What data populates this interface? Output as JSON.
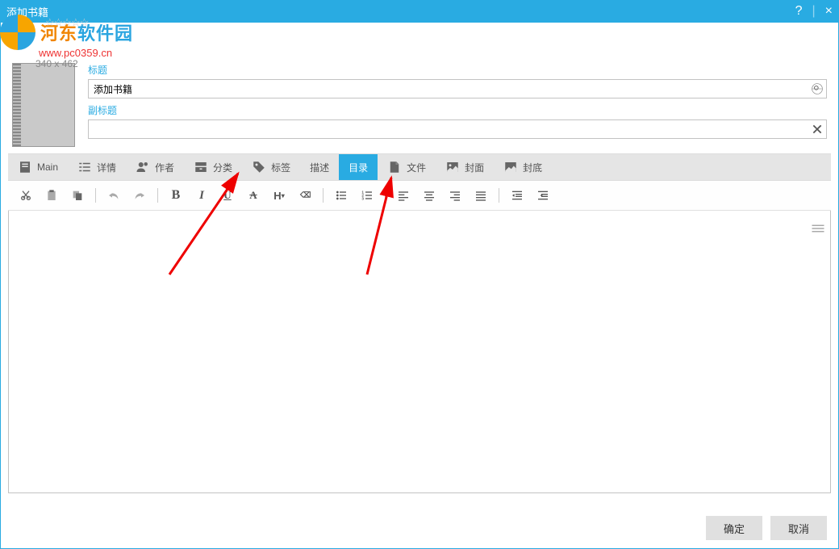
{
  "window": {
    "title": "添加书籍",
    "help": "?",
    "close": "×"
  },
  "watermark": {
    "brand_colored": "河东",
    "brand_rest": "软件园",
    "url": "www.pc0359.cn",
    "dimensions": "340 x  462",
    "stars": "☆☆☆☆☆"
  },
  "fields": {
    "title_label": "标题",
    "title_value": "添加书籍",
    "subtitle_label": "副标题",
    "subtitle_value": ""
  },
  "tabs": [
    {
      "id": "main",
      "label": "Main",
      "icon": "doc"
    },
    {
      "id": "detail",
      "label": "详情",
      "icon": "list"
    },
    {
      "id": "author",
      "label": "作者",
      "icon": "person"
    },
    {
      "id": "category",
      "label": "分类",
      "icon": "drawer"
    },
    {
      "id": "tag",
      "label": "标签",
      "icon": "tag"
    },
    {
      "id": "desc",
      "label": "描述",
      "icon": ""
    },
    {
      "id": "toc",
      "label": "目录",
      "icon": "",
      "active": true
    },
    {
      "id": "file",
      "label": "文件",
      "icon": "file"
    },
    {
      "id": "cover",
      "label": "封面",
      "icon": "image"
    },
    {
      "id": "back",
      "label": "封底",
      "icon": "image2"
    }
  ],
  "active_tab_index": 6,
  "toolbar": {
    "groups": [
      [
        "cut",
        "paste",
        "copy"
      ],
      [
        "undo",
        "redo"
      ],
      [
        "bold",
        "italic",
        "underline",
        "strike",
        "heading",
        "format"
      ],
      [
        "ulist",
        "olist"
      ],
      [
        "align-left",
        "align-center",
        "align-right",
        "align-justify"
      ],
      [
        "indent",
        "outdent"
      ]
    ],
    "options": "options"
  },
  "footer": {
    "ok": "确定",
    "cancel": "取消"
  }
}
